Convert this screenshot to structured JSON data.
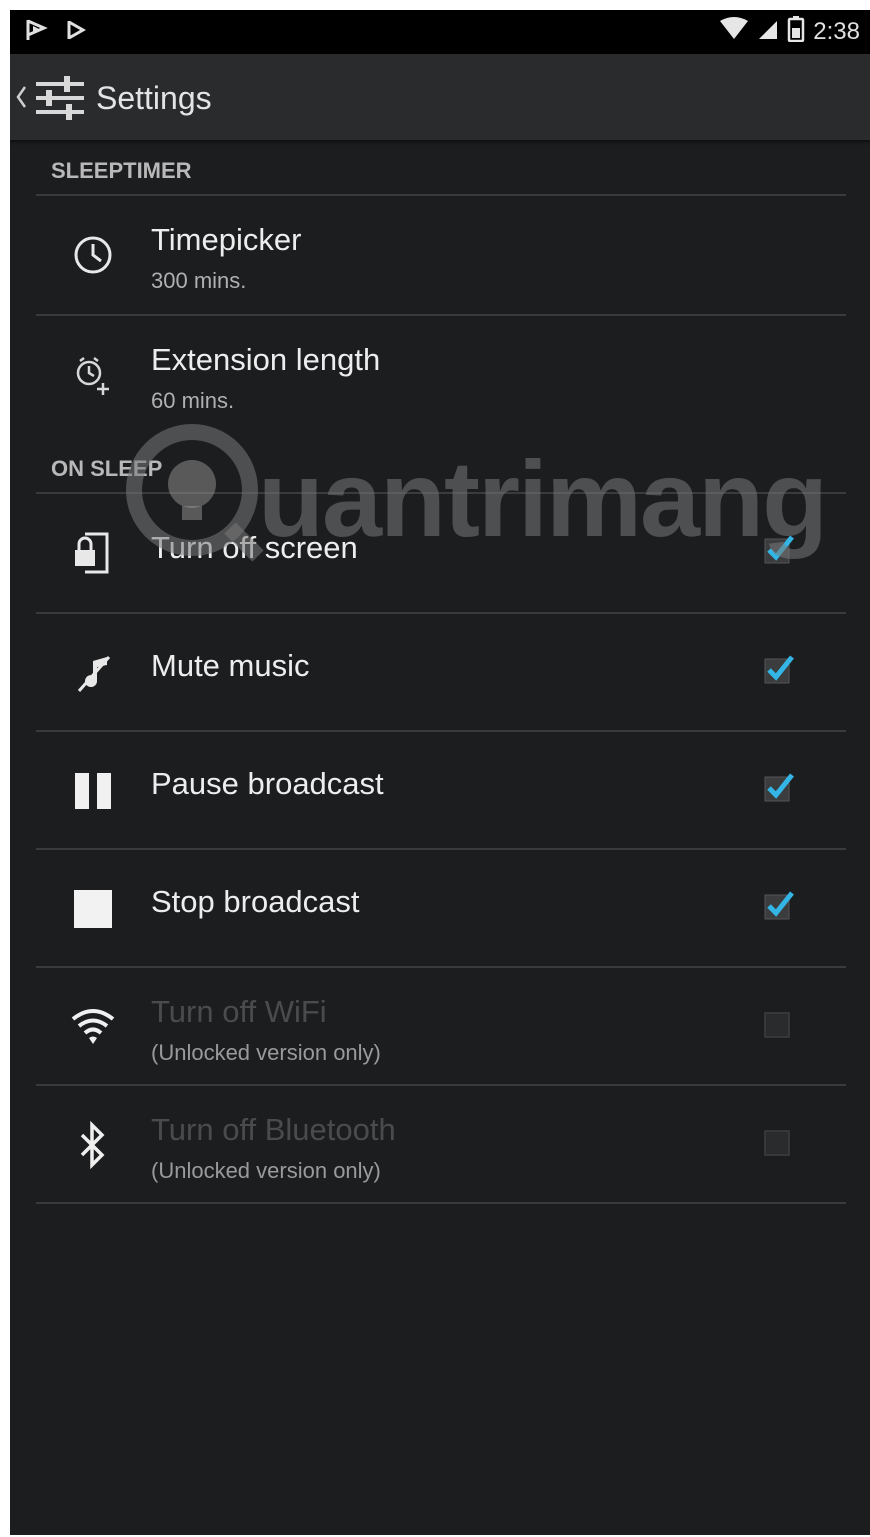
{
  "statusbar": {
    "time": "2:38"
  },
  "actionbar": {
    "title": "Settings"
  },
  "sections": [
    {
      "header": "SLEEPTIMER"
    },
    {
      "header": "ON SLEEP"
    }
  ],
  "sleeptimer": {
    "timepicker": {
      "label": "Timepicker",
      "value": "300 mins."
    },
    "extension": {
      "label": "Extension length",
      "value": "60 mins."
    }
  },
  "on_sleep": {
    "turn_off_screen": {
      "label": "Turn off screen",
      "checked": true
    },
    "mute_music": {
      "label": "Mute music",
      "checked": true
    },
    "pause_broadcast": {
      "label": "Pause broadcast",
      "checked": true
    },
    "stop_broadcast": {
      "label": "Stop broadcast",
      "checked": true
    },
    "turn_off_wifi": {
      "label": "Turn off WiFi",
      "sub": "(Unlocked version only)",
      "checked": false
    },
    "turn_off_bluetooth": {
      "label": "Turn off Bluetooth",
      "sub": "(Unlocked version only)",
      "checked": false
    }
  },
  "watermark": {
    "text": "uantrimang"
  },
  "colors": {
    "accent": "#33b5e5",
    "background": "#1c1d1f"
  }
}
